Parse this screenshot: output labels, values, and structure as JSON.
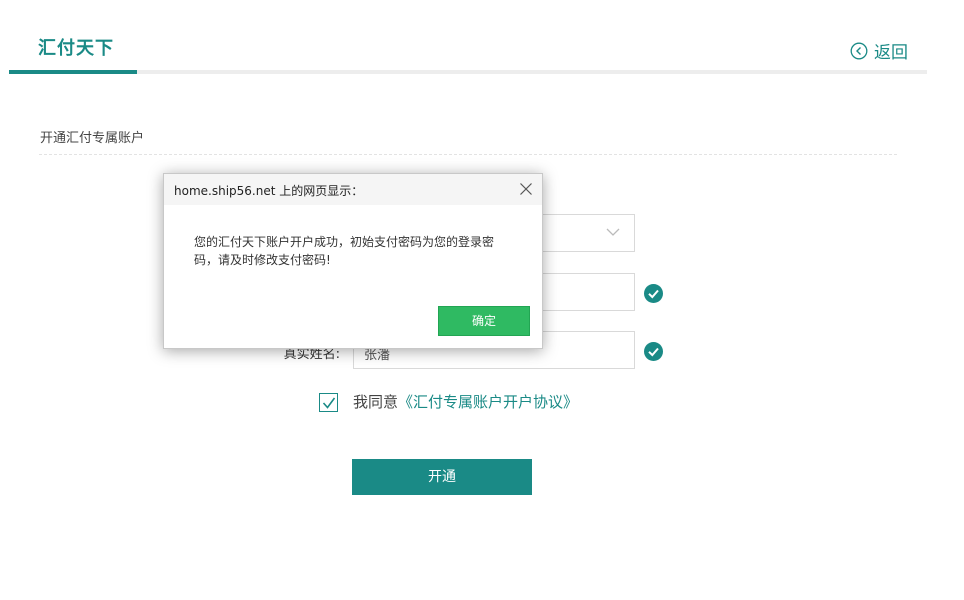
{
  "header": {
    "tab_title": "汇付天下",
    "back_label": "返回"
  },
  "section": {
    "title": "开通汇付专属账户"
  },
  "form": {
    "field3_label": "真实姓名:",
    "field3_value": "张潘"
  },
  "agreement": {
    "prefix": "我同意",
    "link_text": "《汇付专属账户开户协议》",
    "checked": true
  },
  "submit": {
    "label": "开通"
  },
  "dialog": {
    "title": "home.ship56.net 上的网页显示：",
    "message": "您的汇付天下账户开户成功，初始支付密码为您的登录密码，请及时修改支付密码!",
    "ok_label": "确定"
  },
  "colors": {
    "accent": "#1a8a86",
    "ok_button": "#2fba62"
  },
  "icons": {
    "back": "circle-chevron-left-icon",
    "select": "chevron-down-icon",
    "valid": "check-circle-icon",
    "close": "close-icon"
  }
}
